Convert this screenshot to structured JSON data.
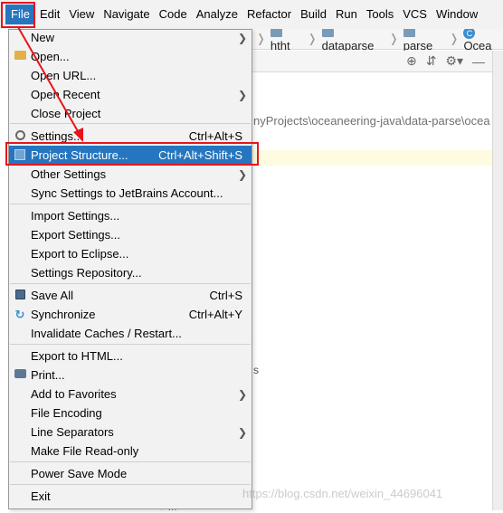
{
  "menubar": {
    "items": [
      "File",
      "Edit",
      "View",
      "Navigate",
      "Code",
      "Analyze",
      "Refactor",
      "Build",
      "Run",
      "Tools",
      "VCS",
      "Window"
    ]
  },
  "navbar": {
    "crumbs": [
      "htht",
      "dataparse",
      "parse",
      "Ocea"
    ]
  },
  "editor": {
    "path_fragment": "nyProjects\\oceaneering-java\\data-parse\\ocea",
    "stray_letter": "s",
    "bottom_text": "● ..."
  },
  "file_menu": {
    "new": {
      "label": "New"
    },
    "open": {
      "label": "Open...",
      "icon": "folder-open-icon"
    },
    "open_url": {
      "label": "Open URL..."
    },
    "open_recent": {
      "label": "Open Recent"
    },
    "close_project": {
      "label": "Close Project"
    },
    "settings": {
      "label": "Settings...",
      "shortcut": "Ctrl+Alt+S",
      "icon": "gear-icon"
    },
    "project_structure": {
      "label": "Project Structure...",
      "shortcut": "Ctrl+Alt+Shift+S",
      "icon": "project-structure-icon"
    },
    "other_settings": {
      "label": "Other Settings"
    },
    "sync_settings": {
      "label": "Sync Settings to JetBrains Account..."
    },
    "import_settings": {
      "label": "Import Settings..."
    },
    "export_settings": {
      "label": "Export Settings..."
    },
    "export_eclipse": {
      "label": "Export to Eclipse..."
    },
    "settings_repo": {
      "label": "Settings Repository..."
    },
    "save_all": {
      "label": "Save All",
      "shortcut": "Ctrl+S",
      "icon": "save-icon"
    },
    "synchronize": {
      "label": "Synchronize",
      "shortcut": "Ctrl+Alt+Y",
      "icon": "sync-icon"
    },
    "invalidate": {
      "label": "Invalidate Caches / Restart..."
    },
    "export_html": {
      "label": "Export to HTML..."
    },
    "print": {
      "label": "Print...",
      "icon": "print-icon"
    },
    "add_favorites": {
      "label": "Add to Favorites"
    },
    "file_encoding": {
      "label": "File Encoding"
    },
    "line_separators": {
      "label": "Line Separators"
    },
    "make_readonly": {
      "label": "Make File Read-only"
    },
    "power_save": {
      "label": "Power Save Mode"
    },
    "exit": {
      "label": "Exit"
    }
  },
  "watermark": "https://blog.csdn.net/weixin_44696041",
  "colors": {
    "highlight": "#2675bf",
    "annotation": "#e8141c",
    "menu_bg": "#f2f2f2"
  }
}
